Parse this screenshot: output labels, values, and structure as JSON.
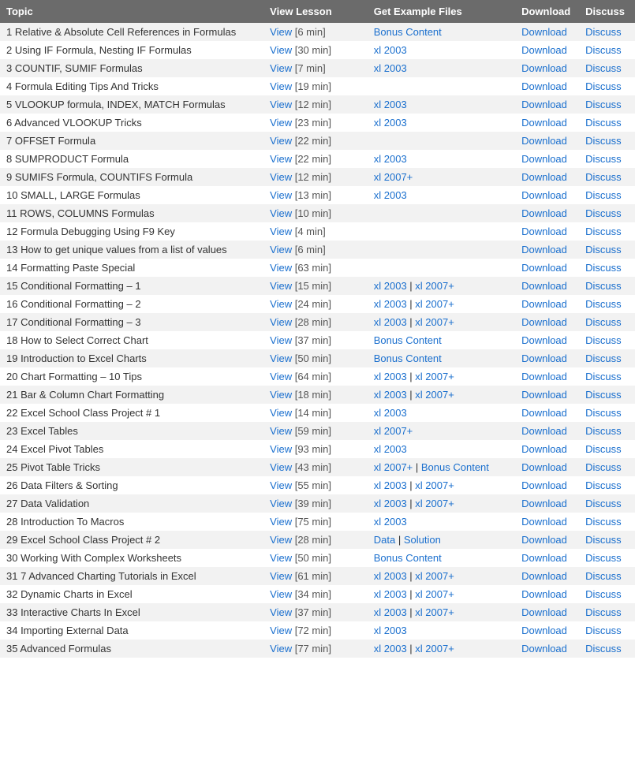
{
  "headers": {
    "topic": "Topic",
    "view": "View Lesson",
    "files": "Get Example Files",
    "download": "Download",
    "discuss": "Discuss"
  },
  "rows": [
    {
      "num": 1,
      "topic": "Relative & Absolute Cell References in Formulas",
      "viewText": "View",
      "duration": "[6 min]",
      "files": [
        {
          "label": "Bonus Content",
          "url": "#"
        }
      ],
      "separators": []
    },
    {
      "num": 2,
      "topic": "Using IF Formula, Nesting IF Formulas",
      "viewText": "View",
      "duration": "[30 min]",
      "files": [
        {
          "label": "xl 2003",
          "url": "#"
        }
      ],
      "separators": []
    },
    {
      "num": 3,
      "topic": "COUNTIF, SUMIF Formulas",
      "viewText": "View",
      "duration": "[7 min]",
      "files": [
        {
          "label": "xl 2003",
          "url": "#"
        }
      ],
      "separators": []
    },
    {
      "num": 4,
      "topic": "Formula Editing Tips And Tricks",
      "viewText": "View",
      "duration": "[19 min]",
      "files": [],
      "separators": []
    },
    {
      "num": 5,
      "topic": "VLOOKUP formula, INDEX, MATCH Formulas",
      "viewText": "View",
      "duration": "[12 min]",
      "files": [
        {
          "label": "xl 2003",
          "url": "#"
        }
      ],
      "separators": []
    },
    {
      "num": 6,
      "topic": "Advanced VLOOKUP Tricks",
      "viewText": "View",
      "duration": "[23 min]",
      "files": [
        {
          "label": "xl 2003",
          "url": "#"
        }
      ],
      "separators": []
    },
    {
      "num": 7,
      "topic": "OFFSET Formula",
      "viewText": "View",
      "duration": "[22 min]",
      "files": [],
      "separators": []
    },
    {
      "num": 8,
      "topic": "SUMPRODUCT Formula",
      "viewText": "View",
      "duration": "[22 min]",
      "files": [
        {
          "label": "xl 2003",
          "url": "#"
        }
      ],
      "separators": []
    },
    {
      "num": 9,
      "topic": "SUMIFS Formula, COUNTIFS Formula",
      "viewText": "View",
      "duration": "[12 min]",
      "files": [
        {
          "label": "xl 2007+",
          "url": "#"
        }
      ],
      "separators": []
    },
    {
      "num": 10,
      "topic": "SMALL, LARGE Formulas",
      "viewText": "View",
      "duration": "[13 min]",
      "files": [
        {
          "label": "xl 2003",
          "url": "#"
        }
      ],
      "separators": []
    },
    {
      "num": 11,
      "topic": "ROWS, COLUMNS Formulas",
      "viewText": "View",
      "duration": "[10 min]",
      "files": [],
      "separators": []
    },
    {
      "num": 12,
      "topic": "Formula Debugging Using F9 Key",
      "viewText": "View",
      "duration": "[4 min]",
      "files": [],
      "separators": []
    },
    {
      "num": 13,
      "topic": "How to get unique values from a list of values",
      "viewText": "View",
      "duration": "[6 min]",
      "files": [],
      "separators": []
    },
    {
      "num": 14,
      "topic": "Formatting Paste Special",
      "viewText": "View",
      "duration": "[63 min]",
      "files": [],
      "separators": []
    },
    {
      "num": 15,
      "topic": "Conditional Formatting – 1",
      "viewText": "View",
      "duration": "[15 min]",
      "files": [
        {
          "label": "xl 2003",
          "url": "#"
        },
        {
          "label": "xl 2007+",
          "url": "#"
        }
      ],
      "separators": [
        "|"
      ]
    },
    {
      "num": 16,
      "topic": "Conditional Formatting – 2",
      "viewText": "View",
      "duration": "[24 min]",
      "files": [
        {
          "label": "xl 2003",
          "url": "#"
        },
        {
          "label": "xl 2007+",
          "url": "#"
        }
      ],
      "separators": [
        "|"
      ]
    },
    {
      "num": 17,
      "topic": "Conditional Formatting – 3",
      "viewText": "View",
      "duration": "[28 min]",
      "files": [
        {
          "label": "xl 2003",
          "url": "#"
        },
        {
          "label": "xl 2007+",
          "url": "#"
        }
      ],
      "separators": [
        "|"
      ]
    },
    {
      "num": 18,
      "topic": "How to Select Correct Chart",
      "viewText": "View",
      "duration": "[37 min]",
      "files": [
        {
          "label": "Bonus Content",
          "url": "#"
        }
      ],
      "separators": []
    },
    {
      "num": 19,
      "topic": "Introduction to Excel Charts",
      "viewText": "View",
      "duration": "[50 min]",
      "files": [
        {
          "label": "Bonus Content",
          "url": "#"
        }
      ],
      "separators": []
    },
    {
      "num": 20,
      "topic": "Chart Formatting – 10 Tips",
      "viewText": "View",
      "duration": "[64 min]",
      "files": [
        {
          "label": "xl 2003",
          "url": "#"
        },
        {
          "label": "xl 2007+",
          "url": "#"
        }
      ],
      "separators": [
        "|"
      ]
    },
    {
      "num": 21,
      "topic": "Bar & Column Chart Formatting",
      "viewText": "View",
      "duration": "[18 min]",
      "files": [
        {
          "label": "xl 2003",
          "url": "#"
        },
        {
          "label": "xl 2007+",
          "url": "#"
        }
      ],
      "separators": [
        "|"
      ]
    },
    {
      "num": 22,
      "topic": "Excel School Class Project # 1",
      "viewText": "View",
      "duration": "[14 min]",
      "files": [
        {
          "label": "xl 2003",
          "url": "#"
        }
      ],
      "separators": []
    },
    {
      "num": 23,
      "topic": "Excel Tables",
      "viewText": "View",
      "duration": "[59 min]",
      "files": [
        {
          "label": "xl 2007+",
          "url": "#"
        }
      ],
      "separators": []
    },
    {
      "num": 24,
      "topic": "Excel Pivot Tables",
      "viewText": "View",
      "duration": "[93 min]",
      "files": [
        {
          "label": "xl 2003",
          "url": "#"
        }
      ],
      "separators": []
    },
    {
      "num": 25,
      "topic": "Pivot Table Tricks",
      "viewText": "View",
      "duration": "[43 min]",
      "files": [
        {
          "label": "xl 2007+",
          "url": "#"
        },
        {
          "label": "Bonus Content",
          "url": "#"
        }
      ],
      "separators": [
        "|"
      ]
    },
    {
      "num": 26,
      "topic": "Data Filters & Sorting",
      "viewText": "View",
      "duration": "[55 min]",
      "files": [
        {
          "label": "xl 2003",
          "url": "#"
        },
        {
          "label": "xl 2007+",
          "url": "#"
        }
      ],
      "separators": [
        "|"
      ]
    },
    {
      "num": 27,
      "topic": "Data Validation",
      "viewText": "View",
      "duration": "[39 min]",
      "files": [
        {
          "label": "xl 2003",
          "url": "#"
        },
        {
          "label": "xl 2007+",
          "url": "#"
        }
      ],
      "separators": [
        "|"
      ]
    },
    {
      "num": 28,
      "topic": "Introduction To Macros",
      "viewText": "View",
      "duration": "[75 min]",
      "files": [
        {
          "label": "xl 2003",
          "url": "#"
        }
      ],
      "separators": []
    },
    {
      "num": 29,
      "topic": "Excel School Class Project # 2",
      "viewText": "View",
      "duration": "[28 min]",
      "files": [
        {
          "label": "Data",
          "url": "#"
        },
        {
          "label": "Solution",
          "url": "#"
        }
      ],
      "separators": [
        "|"
      ]
    },
    {
      "num": 30,
      "topic": "Working With Complex Worksheets",
      "viewText": "View",
      "duration": "[50 min]",
      "files": [
        {
          "label": "Bonus Content",
          "url": "#"
        }
      ],
      "separators": []
    },
    {
      "num": 31,
      "topic": "7 Advanced Charting Tutorials in Excel",
      "viewText": "View",
      "duration": "[61 min]",
      "files": [
        {
          "label": "xl 2003",
          "url": "#"
        },
        {
          "label": "xl 2007+",
          "url": "#"
        }
      ],
      "separators": [
        "|"
      ]
    },
    {
      "num": 32,
      "topic": "Dynamic Charts in Excel",
      "viewText": "View",
      "duration": "[34 min]",
      "files": [
        {
          "label": "xl 2003",
          "url": "#"
        },
        {
          "label": "xl 2007+",
          "url": "#"
        }
      ],
      "separators": [
        "|"
      ]
    },
    {
      "num": 33,
      "topic": "Interactive Charts In Excel",
      "viewText": "View",
      "duration": "[37 min]",
      "files": [
        {
          "label": "xl 2003",
          "url": "#"
        },
        {
          "label": "xl 2007+",
          "url": "#"
        }
      ],
      "separators": [
        "|"
      ]
    },
    {
      "num": 34,
      "topic": "Importing External Data",
      "viewText": "View",
      "duration": "[72 min]",
      "files": [
        {
          "label": "xl 2003",
          "url": "#"
        }
      ],
      "separators": []
    },
    {
      "num": 35,
      "topic": "Advanced Formulas",
      "viewText": "View",
      "duration": "[77 min]",
      "files": [
        {
          "label": "xl 2003",
          "url": "#"
        },
        {
          "label": "xl 2007+",
          "url": "#"
        }
      ],
      "separators": [
        "|"
      ]
    }
  ]
}
